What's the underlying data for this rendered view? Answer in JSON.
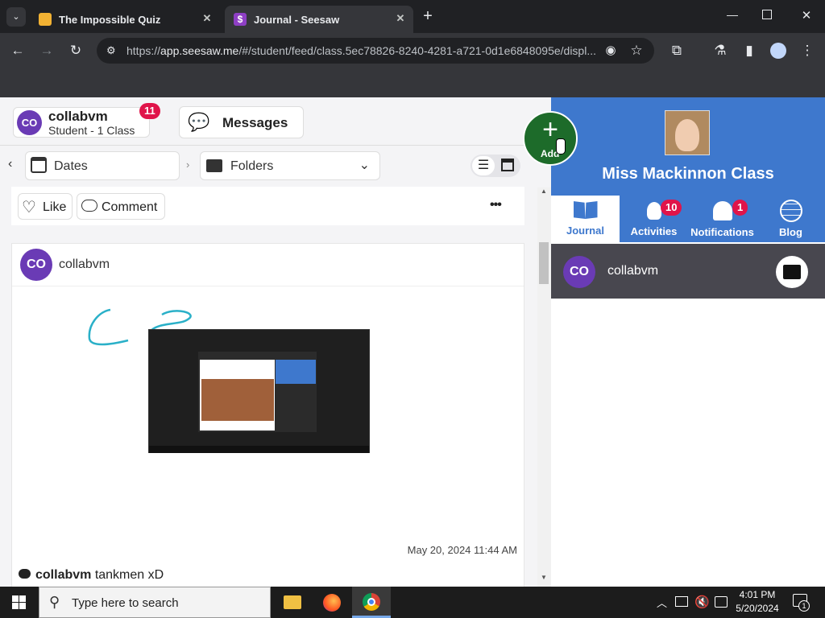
{
  "browser": {
    "tabs": [
      {
        "title": "The Impossible Quiz",
        "favicon_color": "#f2b233",
        "active": false
      },
      {
        "title": "Journal - Seesaw",
        "favicon_color": "#8e3fc4",
        "active": true
      }
    ],
    "url_prefix": "https://",
    "url_host": "app.seesaw.me",
    "url_path": "/#/student/feed/class.5ec78826-8240-4281-a721-0d1e6848095e/displ..."
  },
  "profile": {
    "initials": "CO",
    "name": "collabvm",
    "subtitle": "Student - 1 Class",
    "badge": "11"
  },
  "messages_label": "Messages",
  "filters": {
    "dates_label": "Dates",
    "folders_label": "Folders"
  },
  "actions": {
    "like_label": "Like",
    "comment_label": "Comment",
    "more_label": "•••"
  },
  "add_label": "Add",
  "post": {
    "author_initials": "CO",
    "author": "collabvm",
    "timestamp": "May 20, 2024 11:44 AM",
    "comment_author": "collabvm",
    "comment_text": "tankmen xD"
  },
  "class": {
    "name": "Miss Mackinnon Class"
  },
  "nav": [
    {
      "label": "Journal",
      "icon": "book-icon"
    },
    {
      "label": "Activities",
      "icon": "lightbulb-icon",
      "badge": "10"
    },
    {
      "label": "Notifications",
      "icon": "bell-icon",
      "badge": "1"
    },
    {
      "label": "Blog",
      "icon": "globe-icon"
    }
  ],
  "student": {
    "initials": "CO",
    "name": "collabvm"
  },
  "taskbar": {
    "search_placeholder": "Type here to search",
    "time": "4:01 PM",
    "date": "5/20/2024",
    "notif_count": "1"
  },
  "colors": {
    "accent": "#3e78cd",
    "add_green": "#1d6b2a",
    "badge": "#e0144a",
    "avatar": "#6a3bb5"
  }
}
